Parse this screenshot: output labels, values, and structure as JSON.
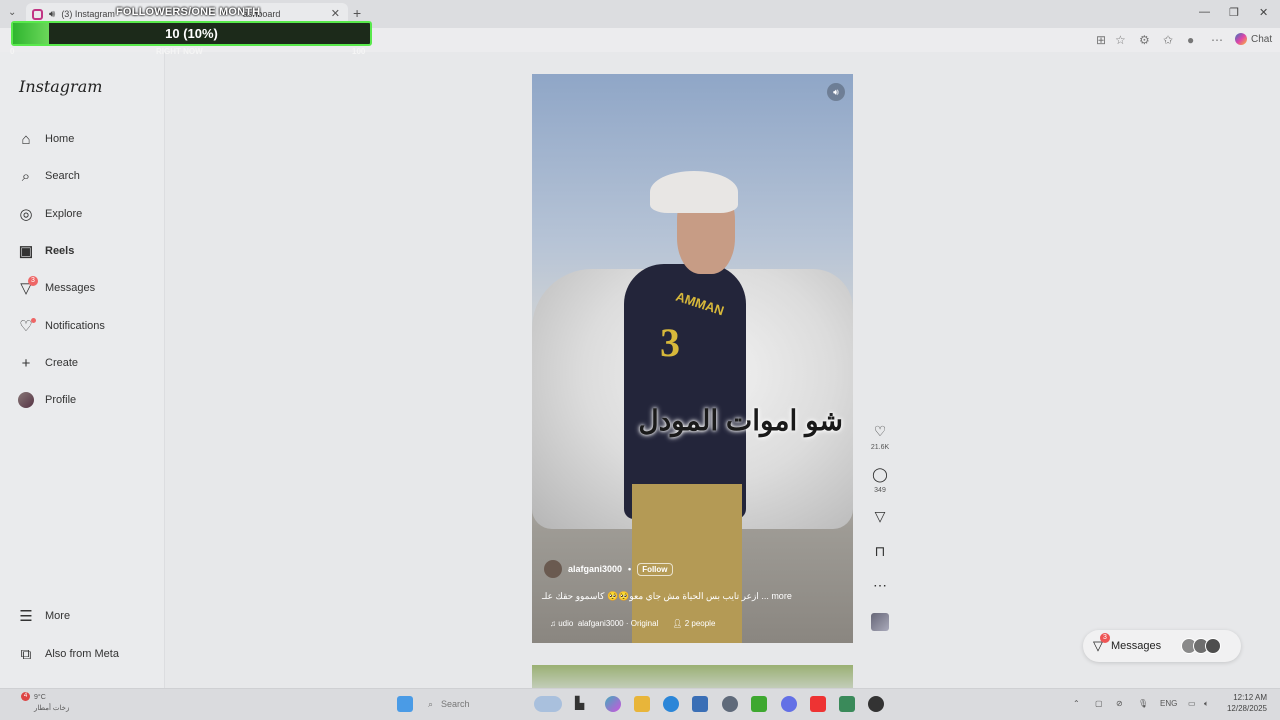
{
  "browser": {
    "tab1_title": "(3) Instagram",
    "tab2_title": "ashboard",
    "chat_label": "Chat"
  },
  "overlay": {
    "title": "FOLLOWERS/ONE MONTH",
    "value_text": "10 (10%)",
    "progress": 0.1,
    "min_label": "0",
    "mid_label": "RIGHT NOW",
    "max_label": "100"
  },
  "sidebar": {
    "logo": "Instagram",
    "items": [
      {
        "label": "Home",
        "icon": "home-icon"
      },
      {
        "label": "Search",
        "icon": "search-icon"
      },
      {
        "label": "Explore",
        "icon": "compass-icon"
      },
      {
        "label": "Reels",
        "icon": "reels-icon"
      },
      {
        "label": "Messages",
        "icon": "messenger-icon",
        "badge": "3"
      },
      {
        "label": "Notifications",
        "icon": "heart-icon"
      },
      {
        "label": "Create",
        "icon": "plus-icon"
      },
      {
        "label": "Profile",
        "icon": "avatar-icon"
      },
      {
        "label": "More",
        "icon": "menu-icon"
      },
      {
        "label": "Also from Meta",
        "icon": "meta-icon"
      }
    ]
  },
  "reel": {
    "caption_overlay": "شو اموات المودل",
    "username": "alafgani3000",
    "follow_label": "Follow",
    "description": "ازعر تايب بس الحياة مش جاي معو🥺🥺 كاسموو حقك علـ ... more",
    "audio": "alafgani3000 · Original",
    "audio_prefix": "udio",
    "people": "2 people",
    "likes": "21.6K",
    "comments": "349"
  },
  "messages_pill": {
    "label": "Messages",
    "badge": "3"
  },
  "taskbar": {
    "weather_temp": "9°C",
    "weather_text": "زخات أمطار",
    "weather_badge": "4",
    "search_placeholder": "Search",
    "lang": "ENG",
    "time": "12:12 AM",
    "date": "12/28/2025"
  }
}
